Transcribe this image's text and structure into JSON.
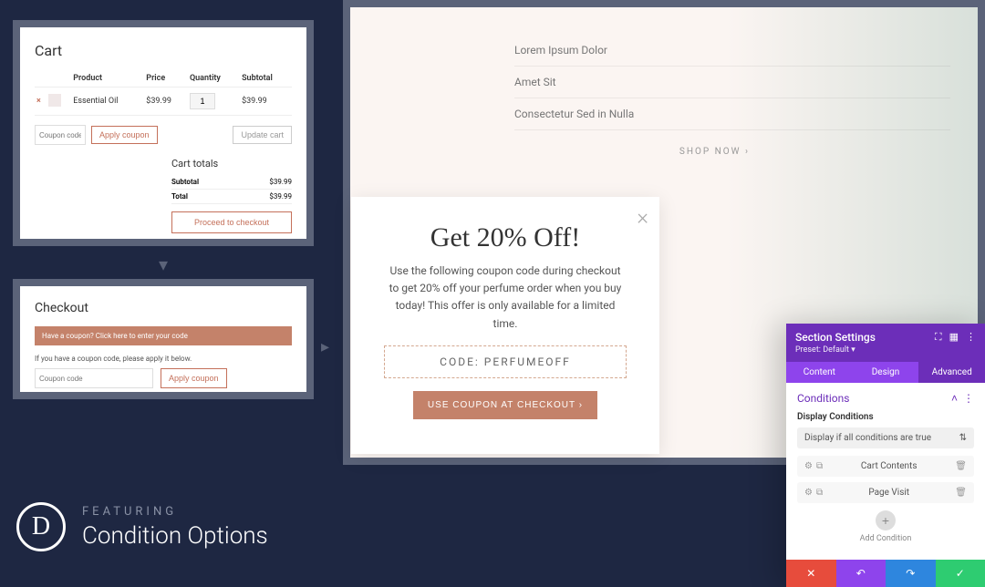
{
  "cart": {
    "title": "Cart",
    "headers": {
      "product": "Product",
      "price": "Price",
      "quantity": "Quantity",
      "subtotal": "Subtotal"
    },
    "item": {
      "name": "Essential Oil",
      "price": "$39.99",
      "qty": "1",
      "subtotal": "$39.99"
    },
    "coupon_placeholder": "Coupon code",
    "apply_label": "Apply coupon",
    "update_label": "Update cart",
    "totals": {
      "title": "Cart totals",
      "subtotal_label": "Subtotal",
      "subtotal_value": "$39.99",
      "total_label": "Total",
      "total_value": "$39.99"
    },
    "proceed_label": "Proceed to checkout"
  },
  "checkout": {
    "title": "Checkout",
    "banner": "Have a coupon? Click here to enter your code",
    "prompt": "If you have a coupon code, please apply it below.",
    "coupon_placeholder": "Coupon code",
    "apply_label": "Apply coupon"
  },
  "bg": {
    "items": [
      "Lorem Ipsum Dolor",
      "Amet Sit",
      "Consectetur Sed in Nulla"
    ],
    "shop_now": "SHOP NOW  ›"
  },
  "popup": {
    "title": "Get 20% Off!",
    "desc": "Use the following coupon code during checkout to get 20% off your perfume order when you buy today! This offer is only available for a limited time.",
    "code": "CODE: PERFUMEOFF",
    "cta": "USE COUPON AT CHECKOUT  ›"
  },
  "settings": {
    "title": "Section Settings",
    "preset": "Preset: Default ▾",
    "tabs": {
      "content": "Content",
      "design": "Design",
      "advanced": "Advanced"
    },
    "section": "Conditions",
    "label": "Display Conditions",
    "select": "Display if all conditions are true",
    "cond1": "Cart Contents",
    "cond2": "Page Visit",
    "add": "Add Condition"
  },
  "feature": {
    "sub": "FEATURING",
    "main": "Condition Options",
    "logo": "D"
  }
}
